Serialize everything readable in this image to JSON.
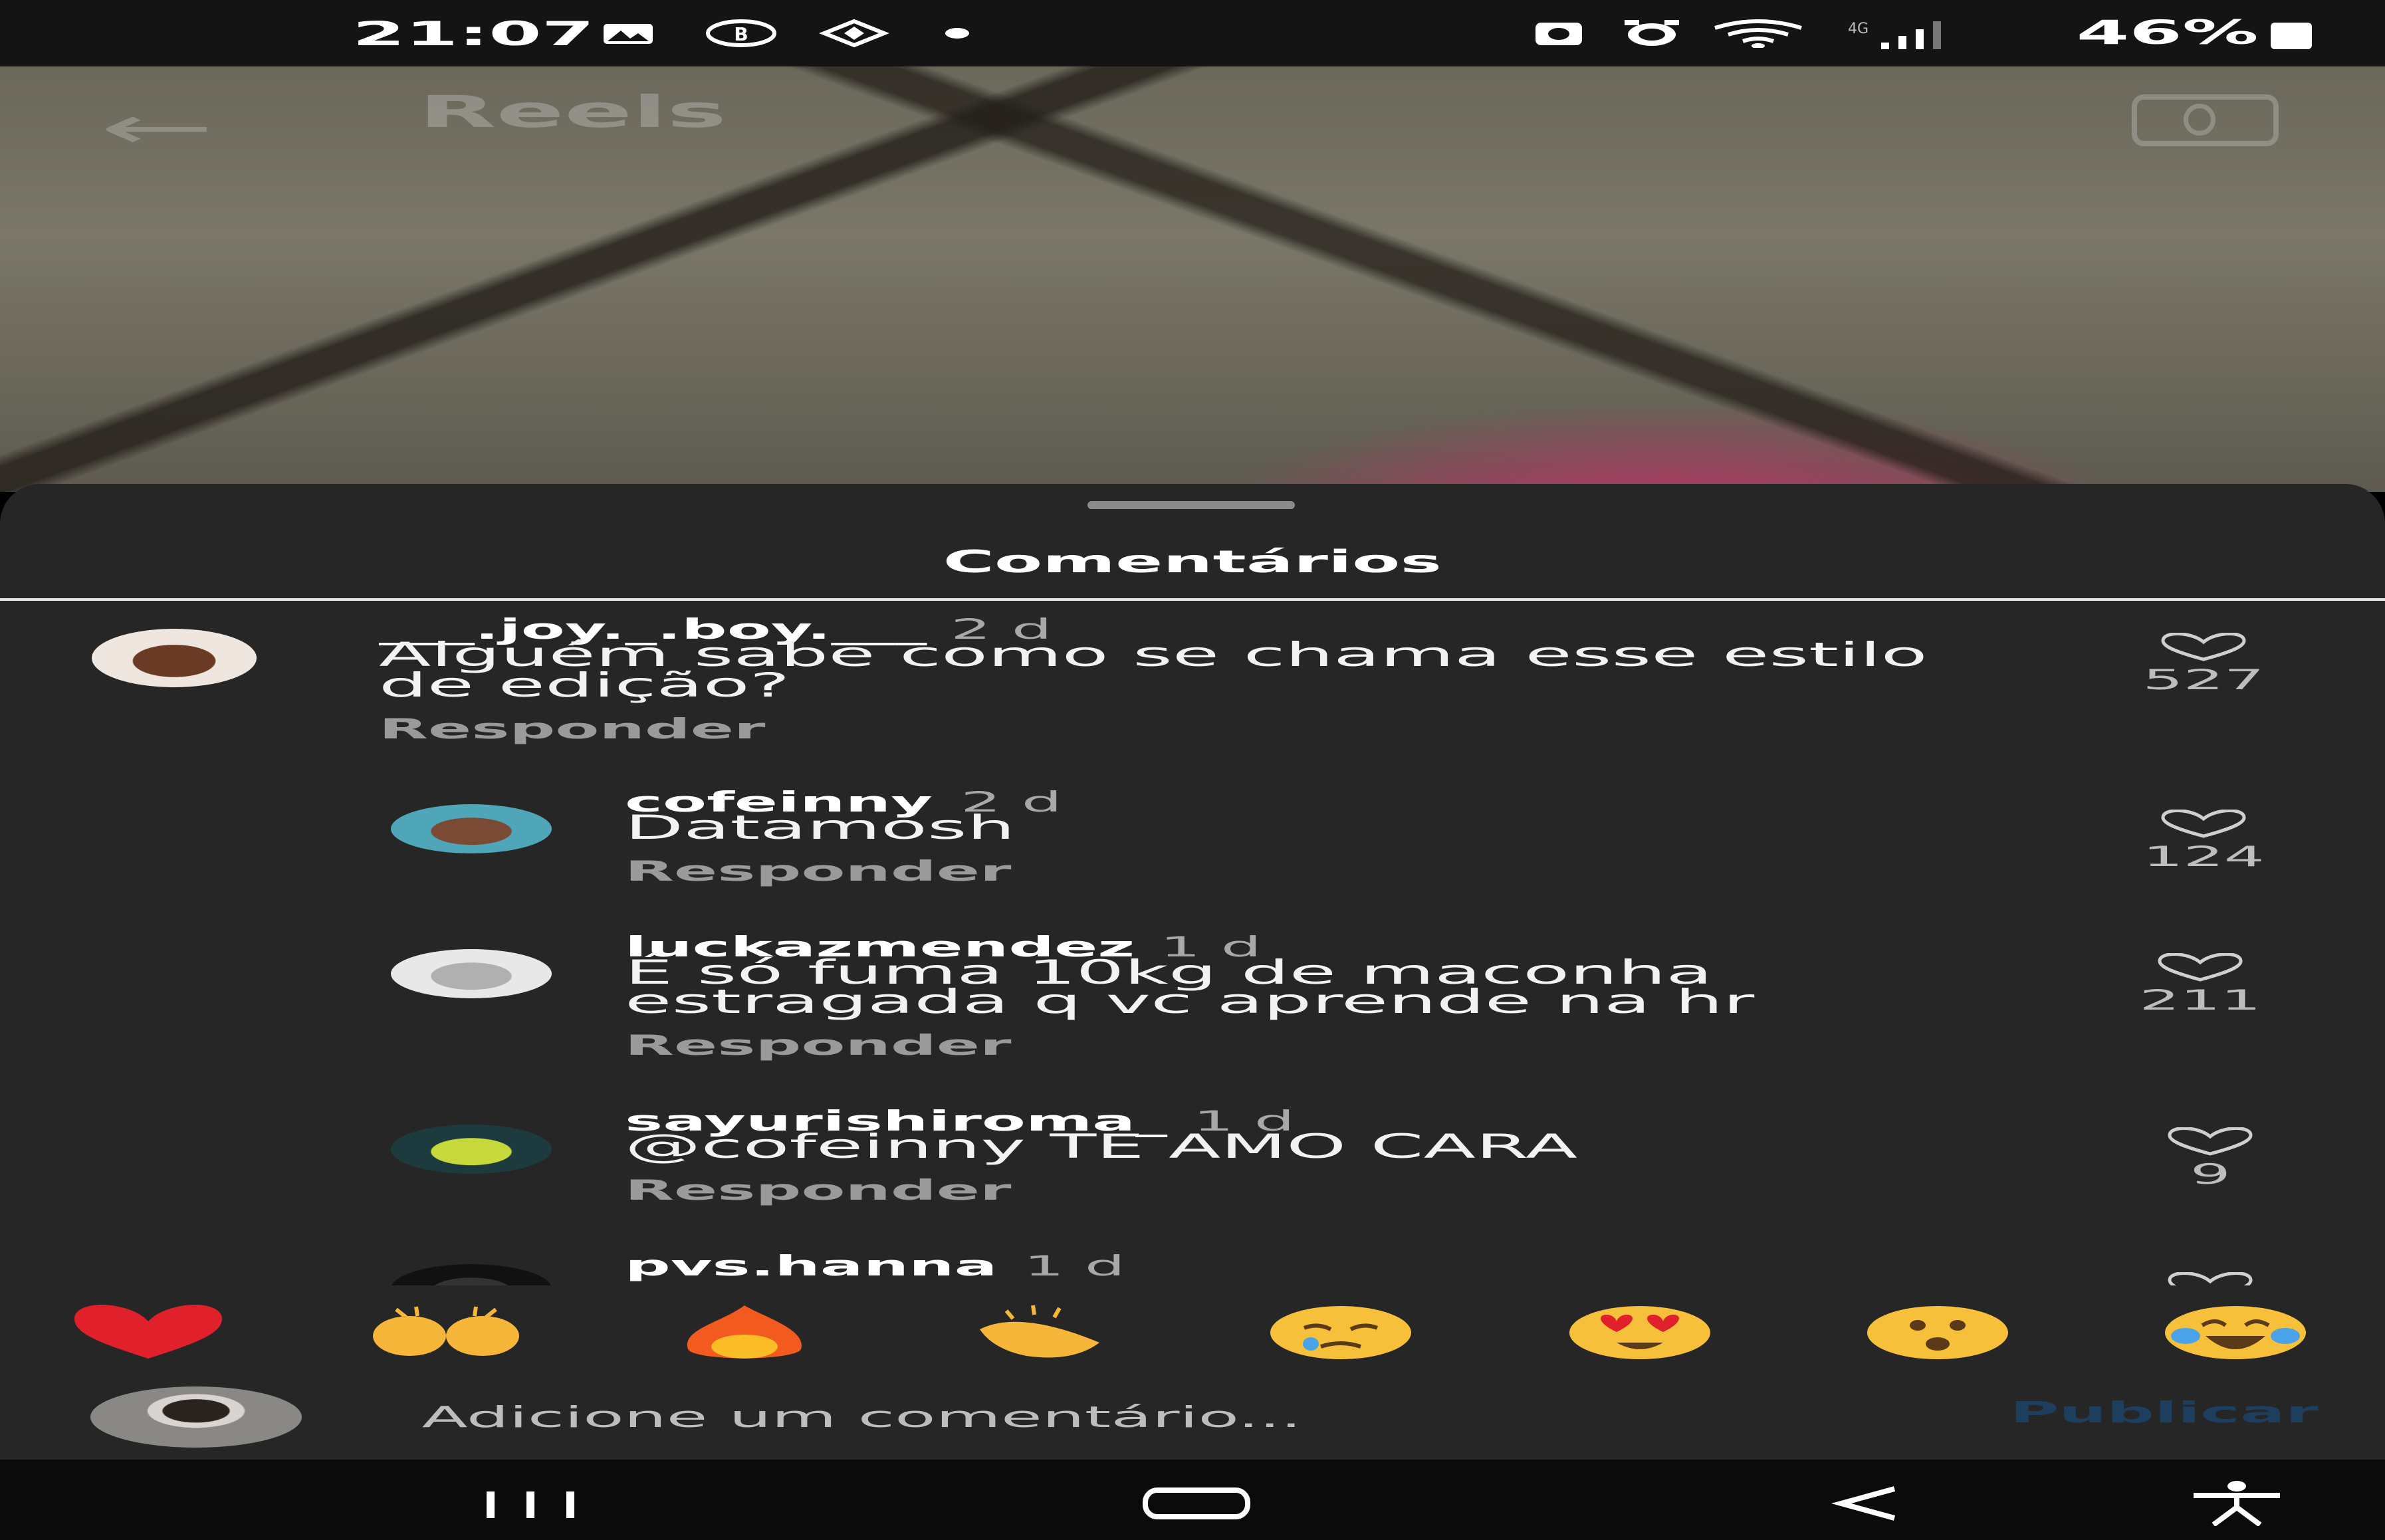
{
  "status_bar": {
    "time": "21:07",
    "battery": "46%",
    "left_icons": [
      "gallery-icon",
      "b-badge-icon",
      "data-saver-icon",
      "dot-icon"
    ],
    "right_icons": [
      "nfc-icon",
      "alarm-icon",
      "wifi-icon",
      "4g-signal-icon"
    ],
    "network_label": "4G"
  },
  "video_header": {
    "title": "Reels",
    "back_icon": "arrow-left-icon",
    "camera_icon": "camera-icon"
  },
  "comments_sheet": {
    "title": "Comentários",
    "reply_label": "Responder",
    "comments": [
      {
        "username": "___.joy._.boy.___",
        "time": "2 d",
        "text_line1": "Alguém sabe como se chama esse estilo",
        "text_line2": "de edição?",
        "likes": "527",
        "is_reply": false,
        "avatar_colors": [
          "#efe6e0",
          "#6b3a25"
        ]
      },
      {
        "username": "cofeinny",
        "time": "2 d",
        "text_line1": "Datamosh",
        "text_line2": "",
        "likes": "124",
        "is_reply": true,
        "avatar_colors": [
          "#4fa6b8",
          "#7a4a35"
        ]
      },
      {
        "username": "luckazmendez",
        "time": "1 d",
        "text_line1": "É só fuma 10kg de maconha",
        "text_line2": "estragada q vc aprende na hr",
        "likes": "211",
        "is_reply": true,
        "avatar_colors": [
          "#e8e8e8",
          "#b0b0b0"
        ]
      },
      {
        "username": "sayurishiroma_",
        "time": "1 d",
        "text_line1": "@cofeinny TE AMO CARA",
        "text_line2": "",
        "likes": "9",
        "is_reply": true,
        "avatar_colors": [
          "#1d3b3e",
          "#c6d83a"
        ]
      },
      {
        "username": "pvs.hanna",
        "time": "1 d",
        "text_line1": "",
        "text_line2": "",
        "likes": "",
        "is_reply": true,
        "avatar_colors": [
          "#111111",
          "#333333"
        ]
      }
    ]
  },
  "quick_reactions": [
    {
      "name": "red-heart-emoji"
    },
    {
      "name": "raising-hands-emoji"
    },
    {
      "name": "fire-emoji"
    },
    {
      "name": "clapping-hands-emoji"
    },
    {
      "name": "crying-face-emoji"
    },
    {
      "name": "heart-eyes-emoji"
    },
    {
      "name": "surprised-face-emoji"
    },
    {
      "name": "tears-of-joy-emoji"
    }
  ],
  "composer": {
    "placeholder": "Adicione um comentário...",
    "publish_label": "Publicar"
  },
  "nav_bar": {
    "buttons": [
      "recents-icon",
      "home-icon",
      "back-icon",
      "accessibility-icon"
    ]
  },
  "colors": {
    "sheet_bg": "#262626",
    "status_bar_bg": "#141414",
    "nav_bar_bg": "#0b0b0b",
    "publish_blue": "#1e3e60",
    "muted_text": "#9a9a9a"
  }
}
